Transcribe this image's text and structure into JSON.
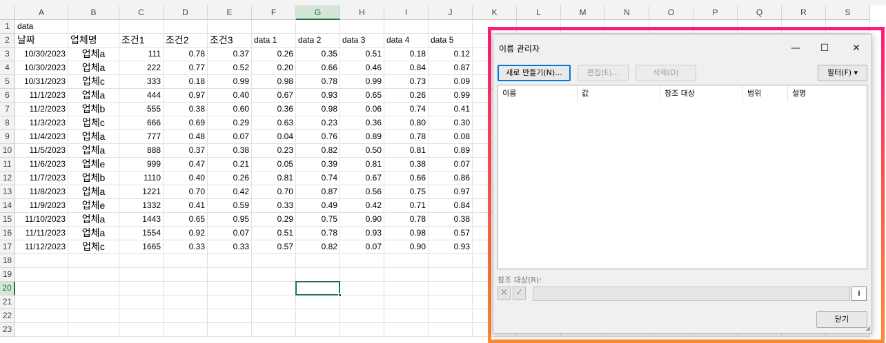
{
  "spreadsheet": {
    "columns": [
      "A",
      "B",
      "C",
      "D",
      "E",
      "F",
      "G",
      "H",
      "I",
      "J",
      "K",
      "L",
      "M",
      "N",
      "O",
      "P",
      "Q",
      "R",
      "S"
    ],
    "rows": [
      "1",
      "2",
      "3",
      "4",
      "5",
      "6",
      "7",
      "8",
      "9",
      "10",
      "11",
      "12",
      "13",
      "14",
      "15",
      "16",
      "17",
      "18",
      "19",
      "20",
      "21",
      "22",
      "23"
    ],
    "selected_column": "G",
    "selected_row": "20",
    "a1": "data",
    "headers": [
      "날짜",
      "업체명",
      "조건1",
      "조건2",
      "조건3",
      "data 1",
      "data 2",
      "data 3",
      "data 4",
      "data 5"
    ],
    "data_rows": [
      [
        "10/30/2023",
        "업체a",
        "111",
        "0.78",
        "0.37",
        "0.26",
        "0.35",
        "0.51",
        "0.18",
        "0.12"
      ],
      [
        "10/30/2023",
        "업체a",
        "222",
        "0.77",
        "0.52",
        "0.20",
        "0.66",
        "0.46",
        "0.84",
        "0.87"
      ],
      [
        "10/31/2023",
        "업체c",
        "333",
        "0.18",
        "0.99",
        "0.98",
        "0.78",
        "0.99",
        "0.73",
        "0.09"
      ],
      [
        "11/1/2023",
        "업체a",
        "444",
        "0.97",
        "0.40",
        "0.67",
        "0.93",
        "0.65",
        "0.26",
        "0.99"
      ],
      [
        "11/2/2023",
        "업체b",
        "555",
        "0.38",
        "0.60",
        "0.36",
        "0.98",
        "0.06",
        "0.74",
        "0.41"
      ],
      [
        "11/3/2023",
        "업체c",
        "666",
        "0.69",
        "0.29",
        "0.63",
        "0.23",
        "0.36",
        "0.80",
        "0.30"
      ],
      [
        "11/4/2023",
        "업체a",
        "777",
        "0.48",
        "0.07",
        "0.04",
        "0.76",
        "0.89",
        "0.78",
        "0.08"
      ],
      [
        "11/5/2023",
        "업체a",
        "888",
        "0.37",
        "0.38",
        "0.23",
        "0.82",
        "0.50",
        "0.81",
        "0.89"
      ],
      [
        "11/6/2023",
        "업체e",
        "999",
        "0.47",
        "0.21",
        "0.05",
        "0.39",
        "0.81",
        "0.38",
        "0.07"
      ],
      [
        "11/7/2023",
        "업체b",
        "1110",
        "0.40",
        "0.26",
        "0.81",
        "0.74",
        "0.67",
        "0.66",
        "0.86"
      ],
      [
        "11/8/2023",
        "업체a",
        "1221",
        "0.70",
        "0.42",
        "0.70",
        "0.87",
        "0.56",
        "0.75",
        "0.97"
      ],
      [
        "11/9/2023",
        "업체e",
        "1332",
        "0.41",
        "0.59",
        "0.33",
        "0.49",
        "0.42",
        "0.71",
        "0.84"
      ],
      [
        "11/10/2023",
        "업체a",
        "1443",
        "0.65",
        "0.95",
        "0.29",
        "0.75",
        "0.90",
        "0.78",
        "0.38"
      ],
      [
        "11/11/2023",
        "업체a",
        "1554",
        "0.92",
        "0.07",
        "0.51",
        "0.78",
        "0.93",
        "0.98",
        "0.57"
      ],
      [
        "11/12/2023",
        "업체c",
        "1665",
        "0.33",
        "0.33",
        "0.57",
        "0.82",
        "0.07",
        "0.90",
        "0.93"
      ]
    ]
  },
  "dialog": {
    "title": "이름 관리자",
    "minimize_icon": "minimize-icon",
    "maximize_icon": "maximize-icon",
    "close_icon": "close-icon",
    "new_label": "새로 만들기(N)...",
    "edit_label": "편집(E)...",
    "delete_label": "삭제(D)",
    "filter_label": "필터(F) ▾",
    "list_headers": [
      "이름",
      "값",
      "참조 대상",
      "범위",
      "설명"
    ],
    "refers_to_label": "참조 대상(R):",
    "refers_to_value": "",
    "close_label": "닫기"
  },
  "colors": {
    "accent": "#217346",
    "highlight_top": "#ff1c7a",
    "highlight_bottom": "#ff8a2e",
    "dialog_default_border": "#0078d7"
  }
}
